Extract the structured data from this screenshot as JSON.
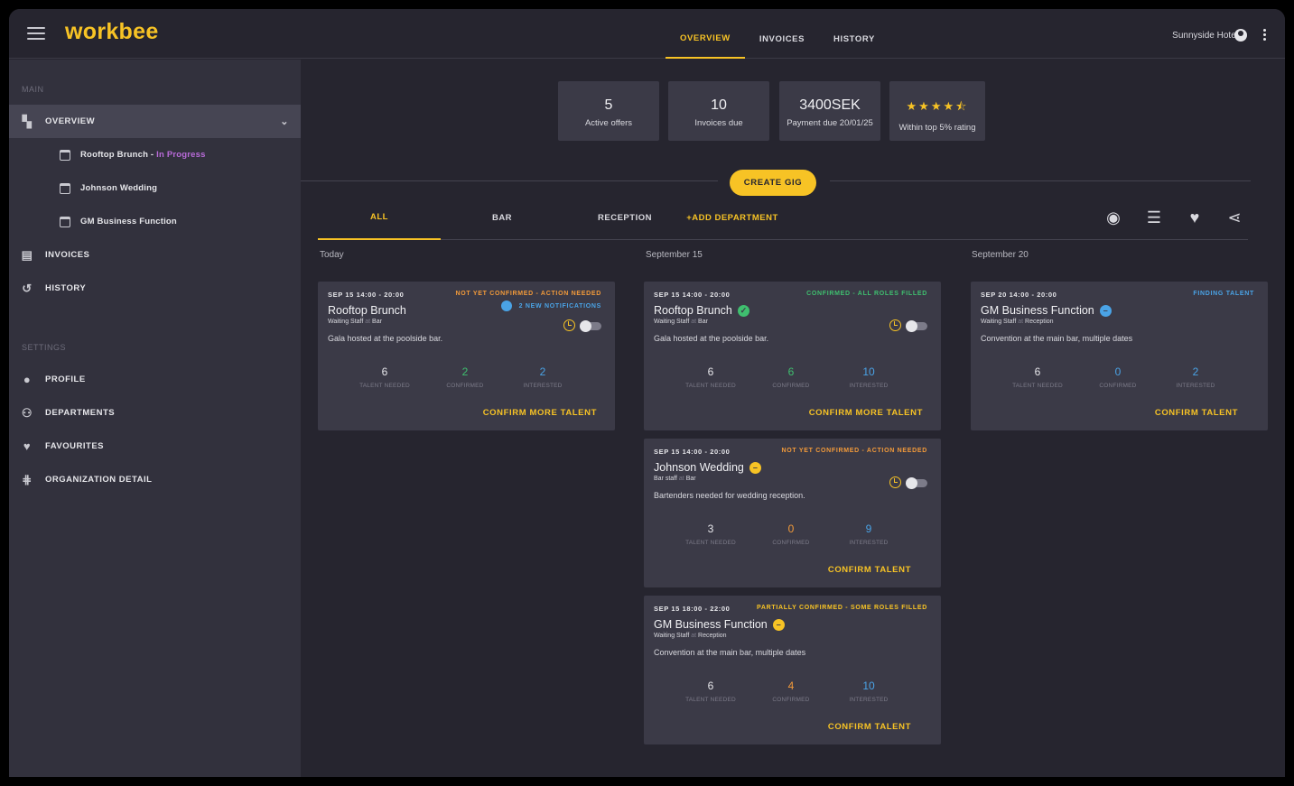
{
  "app": {
    "logo": "workbee",
    "account": "Sunnyside Hotel"
  },
  "top_tabs": [
    "OVERVIEW",
    "INVOICES",
    "HISTORY"
  ],
  "sidebar": {
    "main_section": "MAIN",
    "overview": "OVERVIEW",
    "sub_items": [
      {
        "label": "Rooftop Brunch - ",
        "status": "In Progress"
      },
      {
        "label": "Johnson Wedding",
        "status": ""
      },
      {
        "label": "GM Business Function",
        "status": ""
      }
    ],
    "invoices": "INVOICES",
    "history": "HISTORY",
    "settings_section": "SETTINGS",
    "profile": "PROFILE",
    "departments": "DEPARTMENTS",
    "favourites": "FAVOURITES",
    "organization": "ORGANIZATION DETAIL"
  },
  "stats": [
    {
      "value": "5",
      "label": "Active offers"
    },
    {
      "value": "10",
      "label": "Invoices due"
    },
    {
      "value": "3400SEK",
      "label": "Payment due 20/01/25"
    },
    {
      "rating": 4.5,
      "label": "Within top 5% rating"
    }
  ],
  "create_gig": "CREATE GIG",
  "dept_tabs": [
    "ALL",
    "BAR",
    "RECEPTION",
    "+ADD DEPARTMENT"
  ],
  "columns": [
    "Today",
    "September 15",
    "September 20"
  ],
  "num_labels": {
    "needed": "TALENT NEEDED",
    "confirmed": "CONFIRMED",
    "interested": "INTERESTED"
  },
  "colors": {
    "accent": "#f7c325",
    "green": "#3fbf6f",
    "blue": "#4aa3e6",
    "orange": "#f29a3a",
    "purple": "#b96bd9"
  },
  "cards": [
    {
      "time": "SEP 15 14:00 - 20:00",
      "state": "NOT YET CONFIRMED - ACTION NEEDED",
      "notifications": "2 NEW NOTIFICATIONS",
      "title": "Rooftop Brunch",
      "role": "Waiting Staff",
      "at": "at",
      "place": "Bar",
      "desc": "Gala hosted at the poolside bar.",
      "needed": "6",
      "confirmed": "2",
      "interested": "2",
      "cta": "CONFIRM MORE TALENT"
    },
    {
      "time": "SEP 15 14:00 - 20:00",
      "state": "CONFIRMED - ALL ROLES FILLED",
      "title": "Rooftop Brunch",
      "role": "Waiting Staff",
      "at": "at",
      "place": "Bar",
      "desc": "Gala hosted at the poolside bar.",
      "needed": "6",
      "confirmed": "6",
      "interested": "10",
      "cta": "CONFIRM MORE TALENT"
    },
    {
      "time": "SEP 15 14:00 - 20:00",
      "state": "NOT YET CONFIRMED - ACTION NEEDED",
      "title": "Johnson Wedding",
      "role": "Bar staff",
      "at": "at",
      "place": "Bar",
      "desc": "Bartenders needed for wedding reception.",
      "needed": "3",
      "confirmed": "0",
      "interested": "9",
      "cta": "CONFIRM TALENT"
    },
    {
      "time": "SEP 15 18:00 - 22:00",
      "state": "PARTIALLY CONFIRMED - SOME ROLES FILLED",
      "title": "GM Business Function",
      "role": "Waiting Staff",
      "at": "at",
      "place": "Reception",
      "desc": "Convention at the main bar, multiple dates",
      "needed": "6",
      "confirmed": "4",
      "interested": "10",
      "cta": "CONFIRM TALENT"
    },
    {
      "time": "SEP 20 14:00 - 20:00",
      "state": "FINDING TALENT",
      "title": "GM Business Function",
      "role": "Waiting Staff",
      "at": "at",
      "place": "Reception",
      "desc": "Convention at the main bar, multiple dates",
      "needed": "6",
      "confirmed": "0",
      "interested": "2",
      "cta": "CONFIRM TALENT"
    }
  ]
}
